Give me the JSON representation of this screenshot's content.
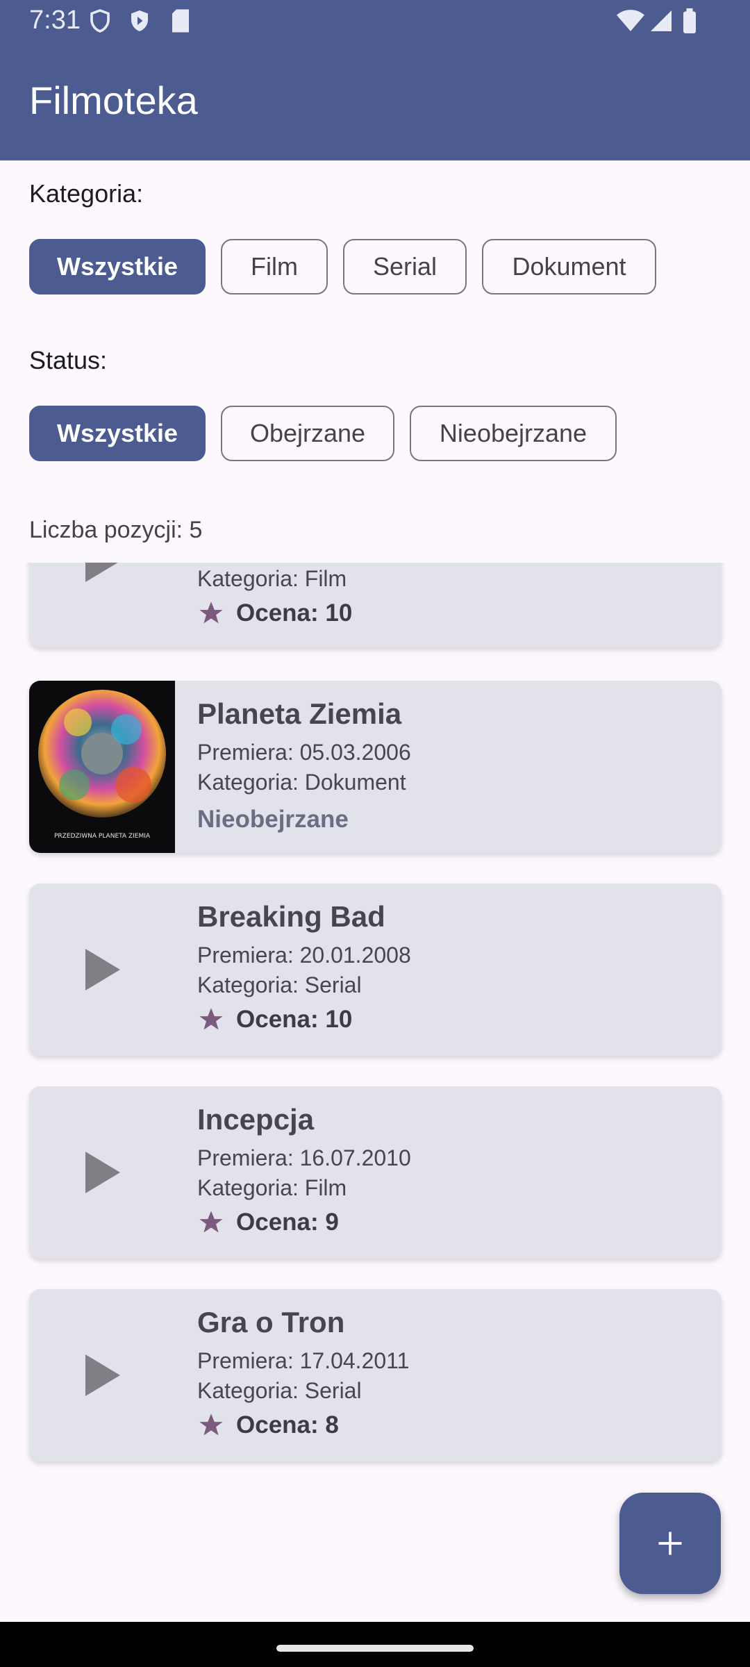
{
  "status_bar": {
    "time": "7:31"
  },
  "app_bar": {
    "title": "Filmoteka"
  },
  "filters": {
    "category_label": "Kategoria:",
    "category_chips": [
      "Wszystkie",
      "Film",
      "Serial",
      "Dokument"
    ],
    "status_label": "Status:",
    "status_chips": [
      "Wszystkie",
      "Obejrzane",
      "Nieobejrzane"
    ]
  },
  "count_text": "Liczba pozycji: 5",
  "items": [
    {
      "category": "Kategoria: Film",
      "rating": "Ocena: 10"
    },
    {
      "title": "Planeta Ziemia",
      "premiere": "Premiera: 05.03.2006",
      "category": "Kategoria: Dokument",
      "status": "Nieobejrzane",
      "poster_text": "PRZEDZIWNA PLANETA ZIEMIA"
    },
    {
      "title": "Breaking Bad",
      "premiere": "Premiera: 20.01.2008",
      "category": "Kategoria: Serial",
      "rating": "Ocena: 10"
    },
    {
      "title": "Incepcja",
      "premiere": "Premiera: 16.07.2010",
      "category": "Kategoria: Film",
      "rating": "Ocena: 9"
    },
    {
      "title": "Gra o Tron",
      "premiere": "Premiera: 17.04.2011",
      "category": "Kategoria: Serial",
      "rating": "Ocena: 8"
    }
  ],
  "colors": {
    "primary": "#4c5b90",
    "card": "#e2e2eb",
    "star": "#7b5a7d"
  },
  "icons": {
    "play": "play-icon",
    "star": "star-icon",
    "add": "add-icon"
  }
}
